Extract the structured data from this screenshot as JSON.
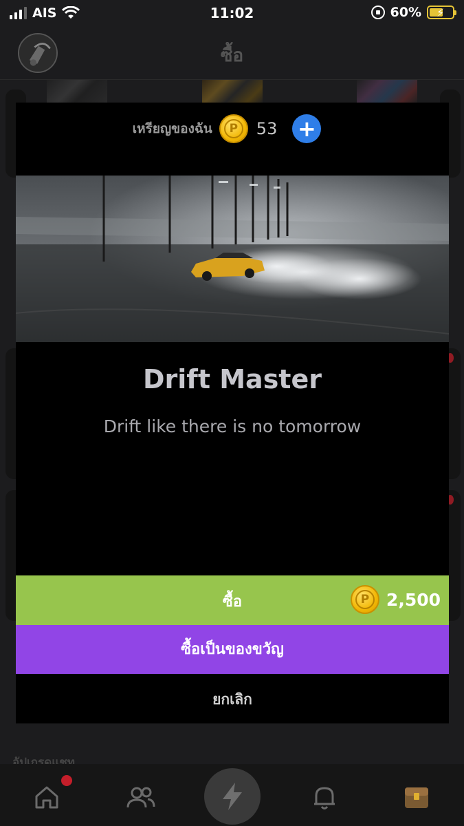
{
  "status_bar": {
    "carrier": "AIS",
    "time": "11:02",
    "battery": "60%"
  },
  "header": {
    "title": "ซื้อ"
  },
  "background": {
    "section_label": "อัปเกรดแชท"
  },
  "modal": {
    "coins_label": "เหรียญของฉัน",
    "coin_symbol": "P",
    "coin_balance": "53",
    "plus_symbol": "+",
    "item_title": "Drift Master",
    "item_description": "Drift like there is no tomorrow",
    "buy_label": "ซื้อ",
    "price": "2,500",
    "gift_label": "ซื้อเป็นของขวัญ",
    "cancel_label": "ยกเลิก"
  },
  "colors": {
    "buy_green": "#97c54d",
    "gift_purple": "#9145e6",
    "plus_blue": "#2f7ee8",
    "coin_gold": "#f2b705",
    "notification_red": "#c41e2a"
  },
  "tab_bar": {
    "icons": [
      "home-icon",
      "friends-icon",
      "lightning-icon",
      "bell-icon",
      "treasure-chest-icon"
    ]
  }
}
